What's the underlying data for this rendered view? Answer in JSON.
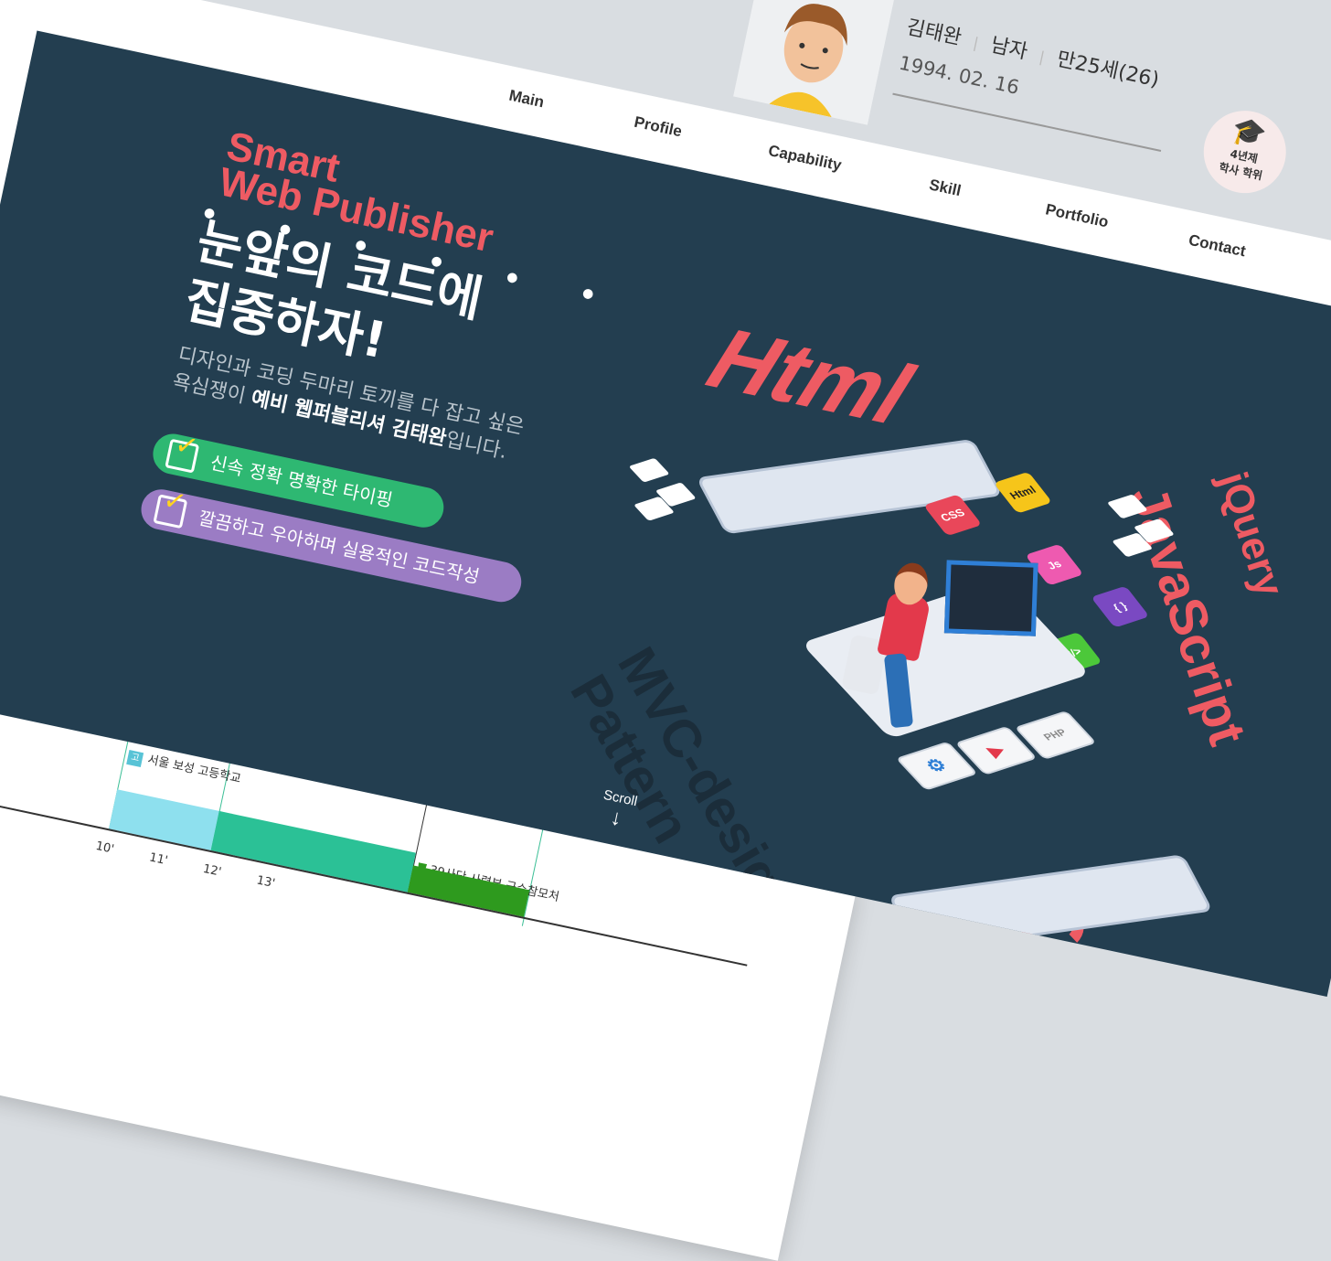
{
  "nav": {
    "items": [
      "Main",
      "Profile",
      "Capability",
      "Skill",
      "Portfolio",
      "Contact"
    ]
  },
  "profile": {
    "name": "김태완",
    "gender": "남자",
    "age": "만25세(26)",
    "birth": "1994. 02. 16",
    "degree_line1": "4년제",
    "degree_line2": "학사 학위"
  },
  "hero": {
    "eyebrow_line1": "Smart",
    "eyebrow_line2": "Web Publisher",
    "headline_line1": "눈앞의 코드에",
    "headline_line2": "집중하자!",
    "sub_line1": "디자인과 코딩 두마리 토끼를 다 잡고 싶은",
    "sub_line2_pre": "욕심쟁이 ",
    "sub_line2_strong": "예비 웹퍼블리셔 김태완",
    "sub_line2_post": "입니다.",
    "pill_green": "신속 정확 명확한 타이핑",
    "pill_purple": "깔끔하고 우아하며 실용적인 코드작성",
    "scroll": "Scroll",
    "colors": {
      "background": "#233e50",
      "accent": "#ee5b63",
      "green": "#2eb872",
      "purple": "#9b7cc4"
    }
  },
  "illustration": {
    "words": [
      "Html",
      "JavaScript",
      "jQuery",
      "CSS",
      "MVC-design",
      "Pattern"
    ],
    "tiles": [
      "CSS",
      "Html",
      "Js",
      "{ }",
      "</>"
    ],
    "stack_labels": [
      "PHP"
    ]
  },
  "timeline": {
    "flags": [
      "서울 보성 고등학교",
      "39사단 사령부 군수참모처"
    ],
    "years": [
      "10'",
      "11'",
      "12'",
      "13'"
    ]
  }
}
